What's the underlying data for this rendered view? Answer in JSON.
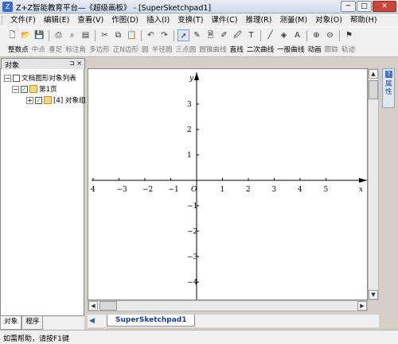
{
  "window": {
    "title": "Z+Z智能教育平台—《超级画板》 - [SuperSketchpad1]",
    "icon": "app-icon"
  },
  "menu": [
    {
      "label": "文件(F)"
    },
    {
      "label": "编辑(E)"
    },
    {
      "label": "查看(V)"
    },
    {
      "label": "作图(D)"
    },
    {
      "label": "插入(I)"
    },
    {
      "label": "变换(T)"
    },
    {
      "label": "课件(C)"
    },
    {
      "label": "推理(R)"
    },
    {
      "label": "测量(M)"
    },
    {
      "label": "对象(O)"
    },
    {
      "label": "帮助(H)"
    }
  ],
  "tools": [
    {
      "label": "整数点",
      "enabled": true
    },
    {
      "label": "中点",
      "enabled": false
    },
    {
      "label": "垂足",
      "enabled": false
    },
    {
      "label": "标注角",
      "enabled": false
    },
    {
      "label": "多边形",
      "enabled": false
    },
    {
      "label": "正N边形",
      "enabled": false
    },
    {
      "label": "圆",
      "enabled": false
    },
    {
      "label": "半径圆",
      "enabled": false
    },
    {
      "label": "三点圆",
      "enabled": false
    },
    {
      "label": "圆锥曲线",
      "enabled": false
    },
    {
      "label": "直线",
      "enabled": true
    },
    {
      "label": "二次曲线",
      "enabled": true
    },
    {
      "label": "一般曲线",
      "enabled": true
    },
    {
      "label": "动画",
      "enabled": true
    },
    {
      "label": "跟踪",
      "enabled": false
    },
    {
      "label": "轨迹",
      "enabled": false
    }
  ],
  "object_panel": {
    "title": "对象",
    "pin": "⊐ ×",
    "tree": [
      {
        "label": "文档图形对象列表",
        "level": 0
      },
      {
        "label": "第1页",
        "level": 1
      },
      {
        "label": "[4] 对象组",
        "level": 2
      }
    ]
  },
  "left_tabs": [
    {
      "label": "对象",
      "active": true
    },
    {
      "label": "程序",
      "active": false
    }
  ],
  "sheet_tab": "SuperSketchpad1",
  "side_dock": "属性",
  "axes": {
    "x_ticks": [
      "4",
      "−3",
      "−2",
      "−1",
      "O",
      "1",
      "2",
      "3",
      "4",
      "5"
    ],
    "y_ticks": [
      "3",
      "2",
      "1",
      "−1",
      "−2",
      "−3",
      "−4"
    ],
    "x_label": "x",
    "y_label": "y"
  },
  "status": "如需帮助，请按F1键"
}
